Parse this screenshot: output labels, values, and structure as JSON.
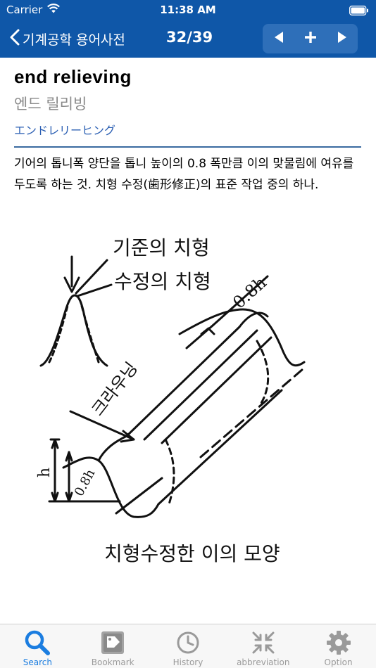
{
  "status_bar": {
    "carrier": "Carrier",
    "time": "11:38 AM"
  },
  "nav": {
    "back_label": "기계공학 용어사전",
    "counter": "32/39",
    "prev_icon": "triangle-left-icon",
    "add_icon": "plus-icon",
    "next_icon": "triangle-right-icon"
  },
  "entry": {
    "headword": "end relieving",
    "korean": "엔드 릴리빙",
    "japanese": "エンドレリーヒング",
    "definition": "기어의 톱니폭 양단을 톱니 높이의 0.8 폭만큼 이의 맞물림에 여유를 두도록 하는 것. 치형 수정(歯形修正)의 표준 작업 중의 하나."
  },
  "figure": {
    "label_reference": "기준의 치형",
    "label_modified": "수정의 치형",
    "label_crowning": "크라우닝",
    "label_08h_top": "0.8h",
    "label_08h_bottom": "0.8h",
    "label_h": "h",
    "caption": "치형수정한 이의 모양"
  },
  "tabs": [
    {
      "label": "Search",
      "icon": "search-icon",
      "active": true
    },
    {
      "label": "Bookmark",
      "icon": "bookmark-icon",
      "active": false
    },
    {
      "label": "History",
      "icon": "clock-icon",
      "active": false
    },
    {
      "label": "abbreviation",
      "icon": "compress-arrows-icon",
      "active": false
    },
    {
      "label": "Option",
      "icon": "gear-icon",
      "active": false
    }
  ],
  "colors": {
    "nav_background": "#0f57a8",
    "accent": "#1b7de0",
    "japanese_text": "#2b5fb3",
    "inactive_tab": "#9a9a9a"
  }
}
